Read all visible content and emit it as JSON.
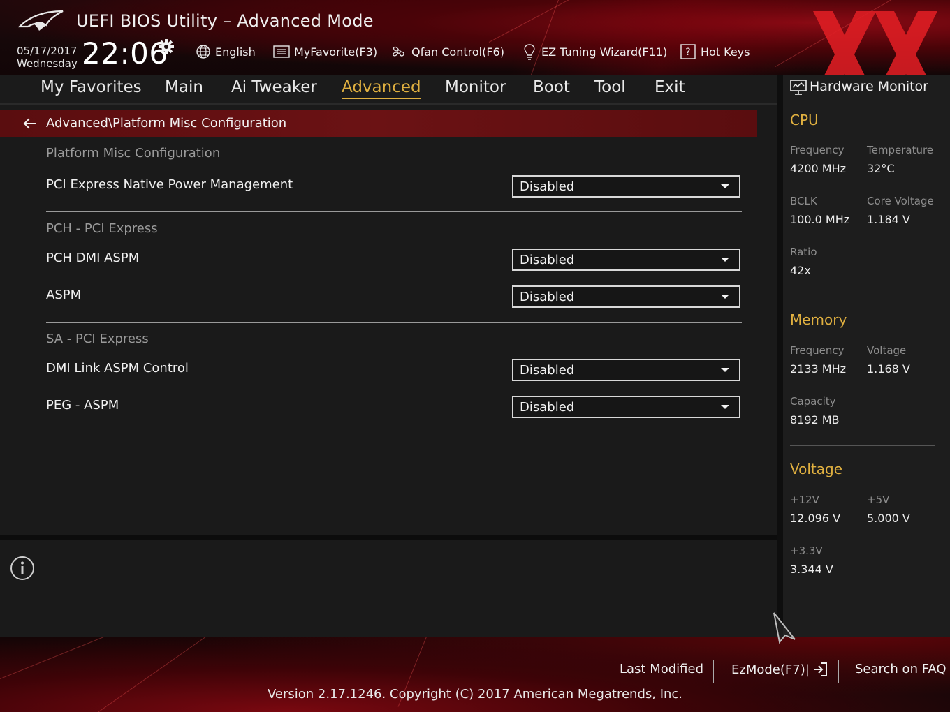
{
  "header": {
    "title": "UEFI BIOS Utility – Advanced Mode",
    "date": "05/17/2017",
    "weekday": "Wednesday",
    "time": "22:06",
    "items": {
      "language": "English",
      "favorite": "MyFavorite(F3)",
      "qfan": "Qfan Control(F6)",
      "ez_tuning": "EZ Tuning Wizard(F11)",
      "hot_keys": "Hot Keys"
    }
  },
  "nav": {
    "tabs": [
      "My Favorites",
      "Main",
      "Ai Tweaker",
      "Advanced",
      "Monitor",
      "Boot",
      "Tool",
      "Exit"
    ],
    "active": "Advanced"
  },
  "main": {
    "breadcrumb": "Advanced\\Platform Misc Configuration",
    "sections": [
      {
        "heading": "Platform Misc Configuration",
        "settings": [
          {
            "label": "PCI Express Native Power Management",
            "value": "Disabled"
          }
        ]
      },
      {
        "heading": "PCH - PCI Express",
        "settings": [
          {
            "label": "PCH DMI ASPM",
            "value": "Disabled"
          },
          {
            "label": "ASPM",
            "value": "Disabled"
          }
        ]
      },
      {
        "heading": "SA - PCI Express",
        "settings": [
          {
            "label": "DMI Link ASPM Control",
            "value": "Disabled"
          },
          {
            "label": "PEG - ASPM",
            "value": "Disabled"
          }
        ]
      }
    ]
  },
  "hardware_monitor": {
    "title": "Hardware Monitor",
    "cpu": {
      "heading": "CPU",
      "frequency_label": "Frequency",
      "frequency": "4200 MHz",
      "temperature_label": "Temperature",
      "temperature": "32°C",
      "bclk_label": "BCLK",
      "bclk": "100.0 MHz",
      "core_voltage_label": "Core Voltage",
      "core_voltage": "1.184 V",
      "ratio_label": "Ratio",
      "ratio": "42x"
    },
    "memory": {
      "heading": "Memory",
      "frequency_label": "Frequency",
      "frequency": "2133 MHz",
      "voltage_label": "Voltage",
      "voltage": "1.168 V",
      "capacity_label": "Capacity",
      "capacity": "8192 MB"
    },
    "voltage": {
      "heading": "Voltage",
      "v12_label": "+12V",
      "v12": "12.096 V",
      "v5_label": "+5V",
      "v5": "5.000 V",
      "v33_label": "+3.3V",
      "v33": "3.344 V"
    }
  },
  "footer": {
    "last_modified": "Last Modified",
    "ezmode": "EzMode(F7)|",
    "search_faq": "Search on FAQ",
    "version": "Version 2.17.1246. Copyright (C) 2017 American Megatrends, Inc."
  },
  "colors": {
    "accent": "#e0b040",
    "breadcrumb_bar": "#6b1214",
    "background": "#1a1a1a"
  },
  "icons": [
    "rog-logo",
    "gear-icon",
    "globe-icon",
    "favorite-list-icon",
    "fan-icon",
    "lightbulb-icon",
    "hotkeys-icon",
    "back-arrow-icon",
    "info-icon",
    "monitor-icon",
    "exit-arrow-icon",
    "mouse-cursor-icon"
  ]
}
